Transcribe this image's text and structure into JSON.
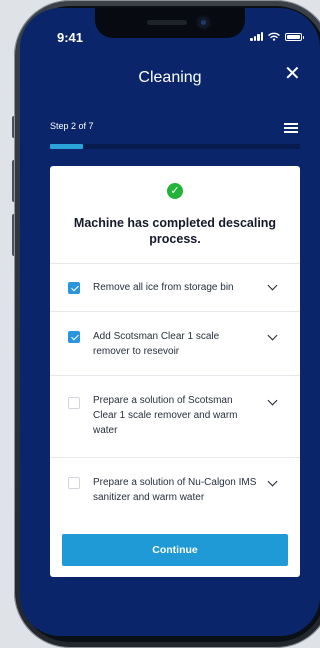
{
  "status_bar": {
    "time": "9:41",
    "icons": [
      "signal-icon",
      "wifi-icon",
      "battery-icon"
    ]
  },
  "header": {
    "title": "Cleaning",
    "close_icon": "close-icon"
  },
  "progress": {
    "step_text": "Step 2 of 7",
    "current_step": 2,
    "total_steps": 7,
    "fill_fraction": 0.13,
    "list_icon": "list-icon"
  },
  "card": {
    "status_icon": "check-circle-icon",
    "heading": "Machine has completed descaling process.",
    "tasks": [
      {
        "label": "Remove all ice from storage bin",
        "checked": true
      },
      {
        "label": "Add Scotsman Clear 1 scale remover to resevoir",
        "checked": true
      },
      {
        "label": "Prepare a solution of Scotsman Clear 1 scale remover and warm water",
        "checked": false
      },
      {
        "label": "Prepare a solution of Nu-Calgon IMS sanitizer and warm water",
        "checked": false
      }
    ],
    "continue_label": "Continue"
  },
  "colors": {
    "screen_background": "#0a2569",
    "accent": "#1f9ad6",
    "checkbox_checked": "#2a94dd",
    "success": "#23b33a"
  }
}
